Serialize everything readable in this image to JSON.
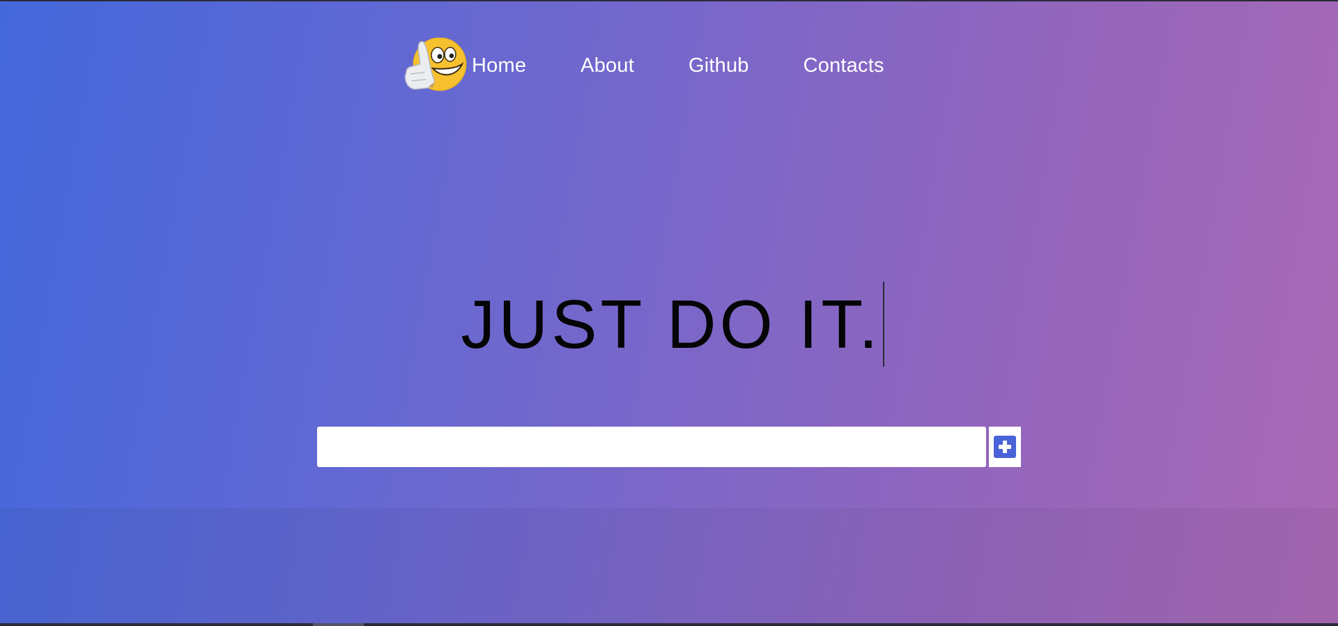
{
  "nav": {
    "logo_icon": "thumbs-up-emoji-icon",
    "items": [
      {
        "label": "Home"
      },
      {
        "label": "About"
      },
      {
        "label": "Github"
      },
      {
        "label": "Contacts"
      }
    ]
  },
  "hero": {
    "title": "JUST DO IT."
  },
  "todo_form": {
    "input_value": "",
    "add_button_icon": "plus-square-icon"
  },
  "colors": {
    "gradient_start": "#4468dc",
    "gradient_end": "#a969b4",
    "text_title": "#050505",
    "nav_text": "#ffffff",
    "add_icon": "#4a63d8"
  }
}
